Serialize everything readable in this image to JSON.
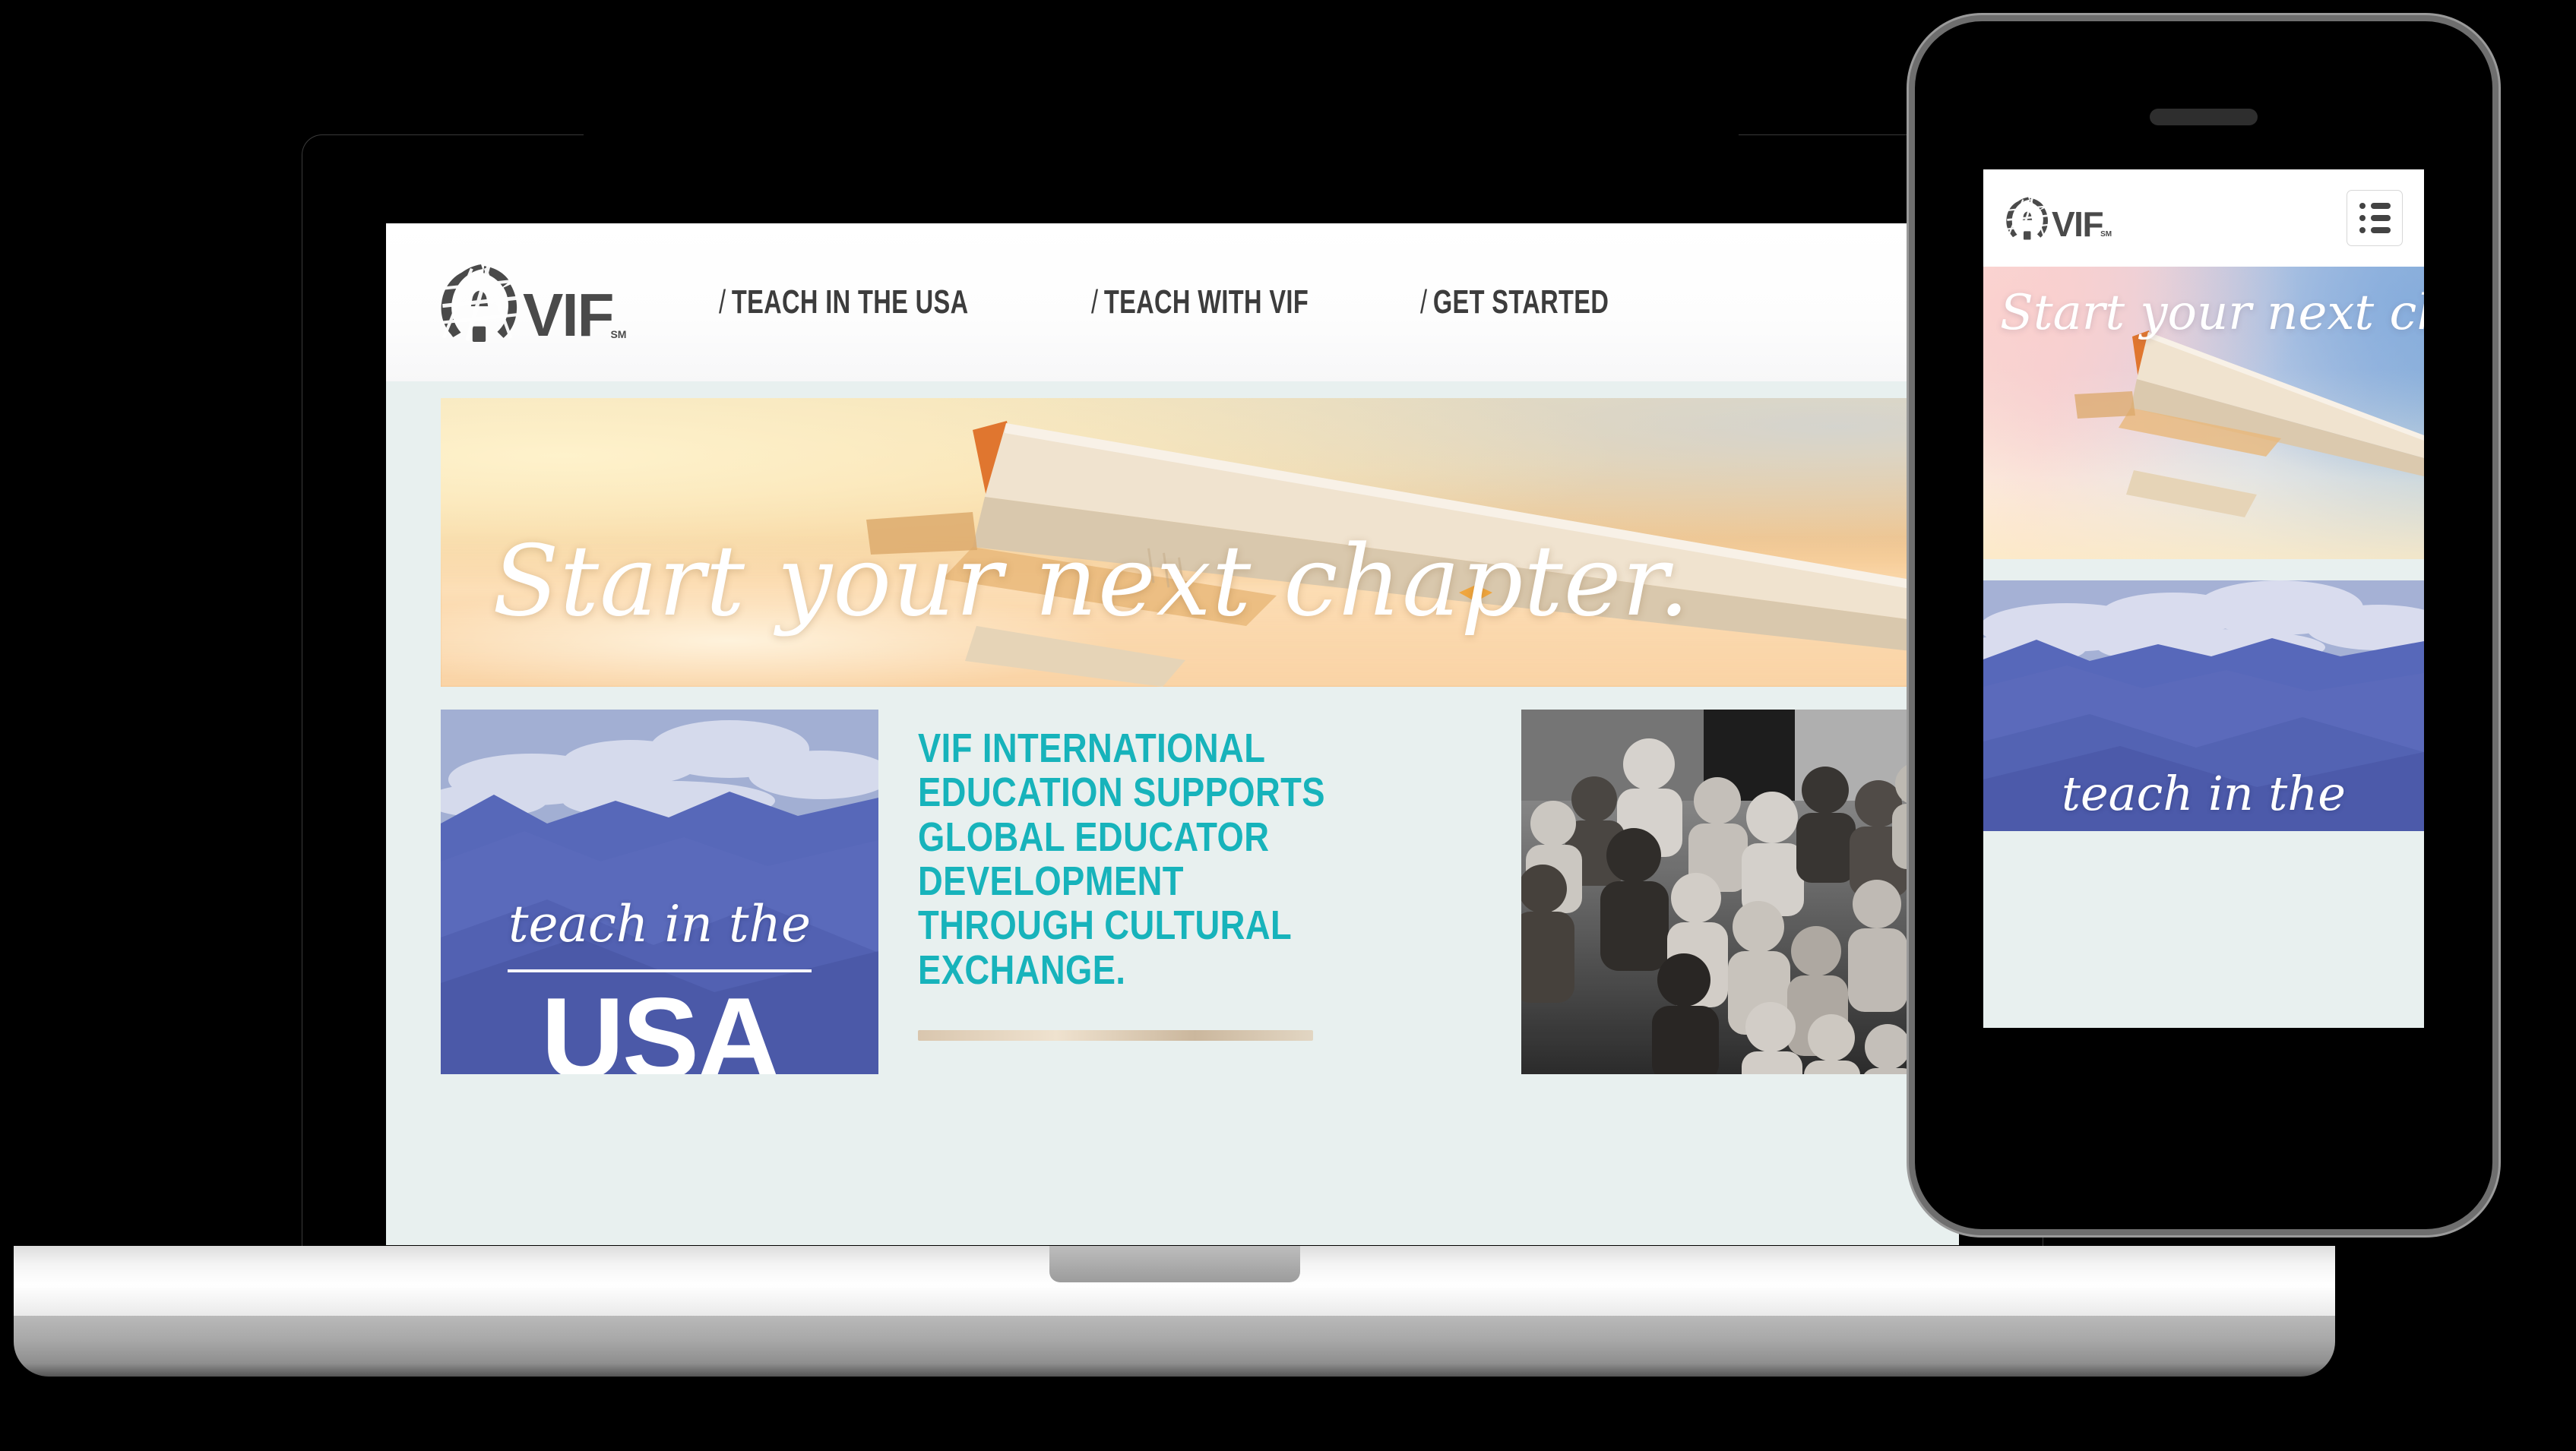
{
  "page": {
    "background_color": "#000000",
    "site_background": "#E8F0EF",
    "accent_teal": "#17B3BB",
    "mountain_blue": "#5566B8"
  },
  "desktop": {
    "header": {
      "logo": {
        "wordmark": "VIF",
        "trademark": "SM",
        "icon": "globe-icon"
      },
      "nav": [
        {
          "slash": "/",
          "label": "TEACH IN THE USA"
        },
        {
          "slash": "/",
          "label": "TEACH WITH VIF"
        },
        {
          "slash": "/",
          "label": "GET STARTED"
        }
      ]
    },
    "hero": {
      "headline": "Start your next chapter.",
      "image_alt": "airplane-wing-sunset-photo"
    },
    "cards": {
      "usa": {
        "script_line": "teach in the",
        "big_line": "USA",
        "image_alt": "blue-mountain-photo"
      },
      "statement": {
        "text": "VIF INTERNATIONAL EDUCATION SUPPORTS GLOBAL EDUCATOR DEVELOPMENT THROUGH CULTURAL EXCHANGE.",
        "lines": [
          "VIF INTERNATIONAL",
          "EDUCATION SUPPORTS",
          "GLOBAL EDUCATOR",
          "DEVELOPMENT",
          "THROUGH CULTURAL",
          "EXCHANGE."
        ]
      },
      "photo": {
        "image_alt": "group-of-teachers-black-and-white-photo"
      }
    }
  },
  "mobile": {
    "header": {
      "logo": {
        "wordmark": "VIF",
        "trademark": "SM",
        "icon": "globe-icon"
      },
      "menu_icon": "list-menu-icon"
    },
    "hero": {
      "headline": "Start your next chapter"
    },
    "section": {
      "script_line": "teach in the"
    }
  }
}
